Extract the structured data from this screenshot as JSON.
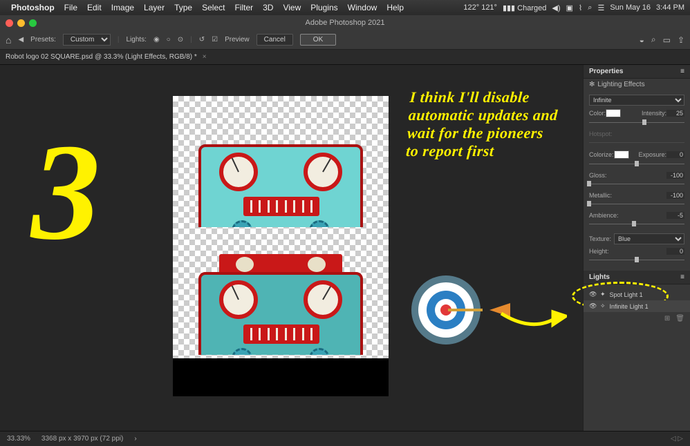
{
  "menubar": {
    "appname": "Photoshop",
    "items": [
      "File",
      "Edit",
      "Image",
      "Layer",
      "Type",
      "Select",
      "Filter",
      "3D",
      "View",
      "Plugins",
      "Window",
      "Help"
    ],
    "temps": "122° 121°",
    "battery": "Charged",
    "date": "Sun May 16",
    "time": "3:44 PM"
  },
  "titlebar": {
    "title": "Adobe Photoshop 2021"
  },
  "optbar": {
    "presets_label": "Presets:",
    "presets_value": "Custom",
    "lights_label": "Lights:",
    "preview": "Preview",
    "cancel": "Cancel",
    "ok": "OK"
  },
  "tab": {
    "name": "Robot logo 02 SQUARE.psd @ 33.3% (Light Effects, RGB/8) *"
  },
  "canvas": {
    "number": "3",
    "comic": "I think I'll disable automatic updates and wait for the pioneers to report first"
  },
  "properties": {
    "title": "Properties",
    "effect": "Lighting Effects",
    "light_type": "Infinite",
    "color_label": "Color:",
    "intensity_label": "Intensity:",
    "intensity_val": "25",
    "hotspot_label": "Hotspot:",
    "hotspot_val": "",
    "colorize_label": "Colorize:",
    "exposure_label": "Exposure:",
    "exposure_val": "0",
    "gloss_label": "Gloss:",
    "gloss_val": "-100",
    "metallic_label": "Metallic:",
    "metallic_val": "-100",
    "ambience_label": "Ambience:",
    "ambience_val": "-5",
    "texture_label": "Texture:",
    "texture_val": "Blue",
    "height_label": "Height:",
    "height_val": "0"
  },
  "lights": {
    "title": "Lights",
    "items": [
      {
        "name": "Spot Light 1",
        "selected": false
      },
      {
        "name": "Infinite Light 1",
        "selected": true
      }
    ]
  },
  "status": {
    "zoom": "33.33%",
    "dims": "3368 px x 3970 px (72 ppi)"
  }
}
